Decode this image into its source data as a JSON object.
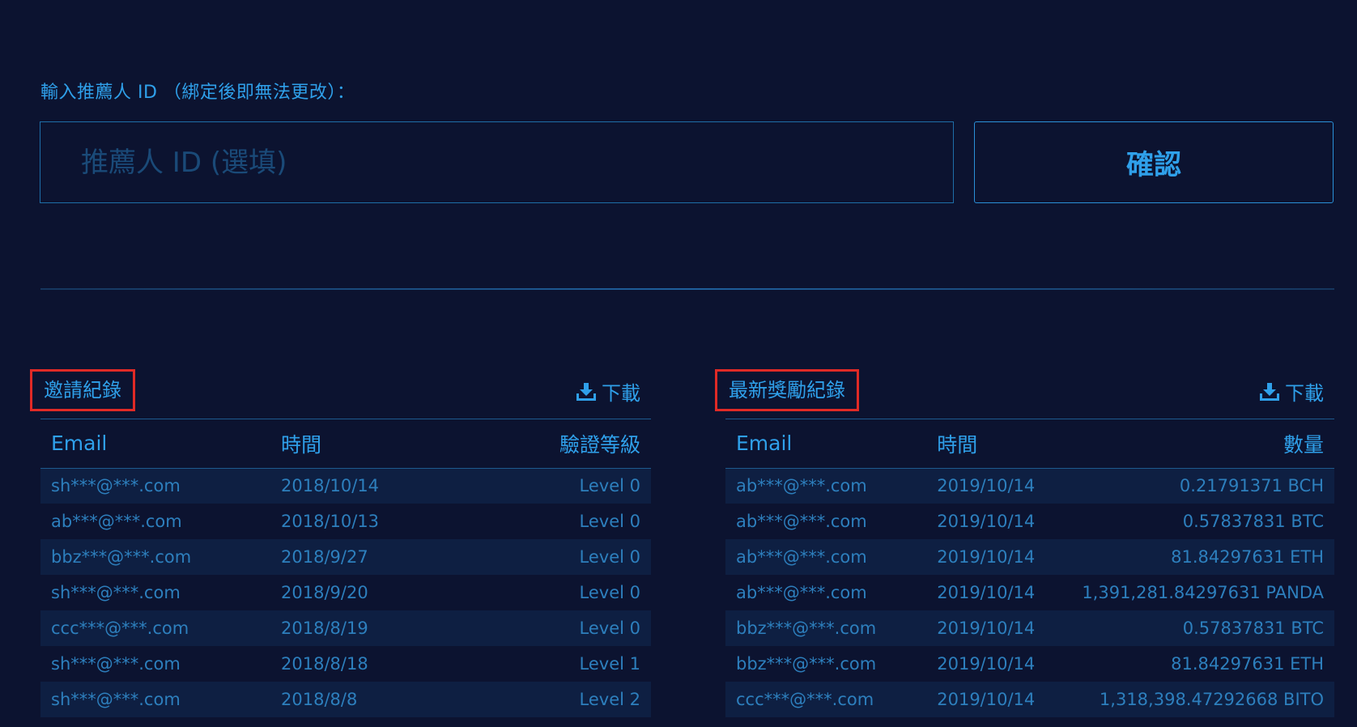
{
  "referrer": {
    "label": "輸入推薦人 ID （綁定後即無法更改）：",
    "placeholder": "推薦人 ID (選填)",
    "confirm_label": "確認"
  },
  "invite_records": {
    "title": "邀請紀錄",
    "download_label": "下載",
    "download_icon": "download-icon",
    "columns": [
      "Email",
      "時間",
      "驗證等級"
    ],
    "rows": [
      [
        "sh***@***.com",
        "2018/10/14",
        "Level 0"
      ],
      [
        "ab***@***.com",
        "2018/10/13",
        "Level 0"
      ],
      [
        "bbz***@***.com",
        "2018/9/27",
        "Level 0"
      ],
      [
        "sh***@***.com",
        "2018/9/20",
        "Level 0"
      ],
      [
        "ccc***@***.com",
        "2018/8/19",
        "Level 0"
      ],
      [
        "sh***@***.com",
        "2018/8/18",
        "Level 1"
      ],
      [
        "sh***@***.com",
        "2018/8/8",
        "Level 2"
      ]
    ]
  },
  "reward_records": {
    "title": "最新獎勵紀錄",
    "download_label": "下載",
    "download_icon": "download-icon",
    "columns": [
      "Email",
      "時間",
      "數量"
    ],
    "rows": [
      [
        "ab***@***.com",
        "2019/10/14",
        "0.21791371 BCH"
      ],
      [
        "ab***@***.com",
        "2019/10/14",
        "0.57837831 BTC"
      ],
      [
        "ab***@***.com",
        "2019/10/14",
        "81.84297631 ETH"
      ],
      [
        "ab***@***.com",
        "2019/10/14",
        "1,391,281.84297631 PANDA"
      ],
      [
        "bbz***@***.com",
        "2019/10/14",
        "0.57837831 BTC"
      ],
      [
        "bbz***@***.com",
        "2019/10/14",
        "81.84297631 ETH"
      ],
      [
        "ccc***@***.com",
        "2019/10/14",
        "1,318,398.47292668 BITO"
      ]
    ]
  },
  "colors": {
    "background": "#0c1330",
    "accent": "#2fa0ea",
    "highlight_box": "#e02a26"
  }
}
